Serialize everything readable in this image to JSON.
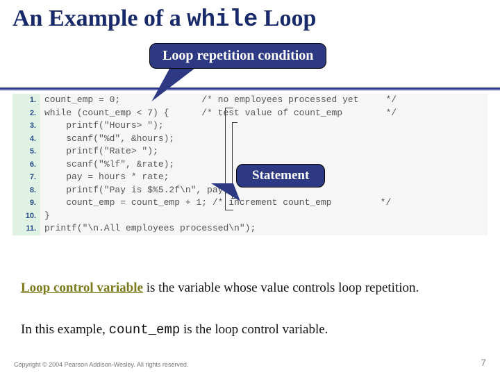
{
  "title": {
    "pre": "An Example of a ",
    "mono": "while",
    "post": " Loop"
  },
  "callouts": {
    "repetition": "Loop repetition condition",
    "statement": "Statement"
  },
  "code": {
    "lines": [
      {
        "ln": "1.",
        "txt": "count_emp = 0;               /* no employees processed yet     */"
      },
      {
        "ln": "2.",
        "txt": "while (count_emp < 7) {      /* test value of count_emp        */"
      },
      {
        "ln": "3.",
        "txt": "    printf(\"Hours> \");"
      },
      {
        "ln": "4.",
        "txt": "    scanf(\"%d\", &hours);"
      },
      {
        "ln": "5.",
        "txt": "    printf(\"Rate> \");"
      },
      {
        "ln": "6.",
        "txt": "    scanf(\"%lf\", &rate);"
      },
      {
        "ln": "7.",
        "txt": "    pay = hours * rate;"
      },
      {
        "ln": "8.",
        "txt": "    printf(\"Pay is $%5.2f\\n\", pay);"
      },
      {
        "ln": "9.",
        "txt": "    count_emp = count_emp + 1; /* increment count_emp         */"
      },
      {
        "ln": "10.",
        "txt": "}"
      },
      {
        "ln": "11.",
        "txt": "printf(\"\\n.All employees processed\\n\");"
      }
    ]
  },
  "paragraphs": {
    "p1_olive": "Loop control variable",
    "p1_rest": " is the variable whose value controls loop repetition.",
    "p2_pre": "In this example, ",
    "p2_mono": "count_emp",
    "p2_post": " is the loop control variable."
  },
  "footer": {
    "copyright": "Copyright © 2004 Pearson Addison-Wesley. All rights reserved.",
    "page": "7"
  }
}
